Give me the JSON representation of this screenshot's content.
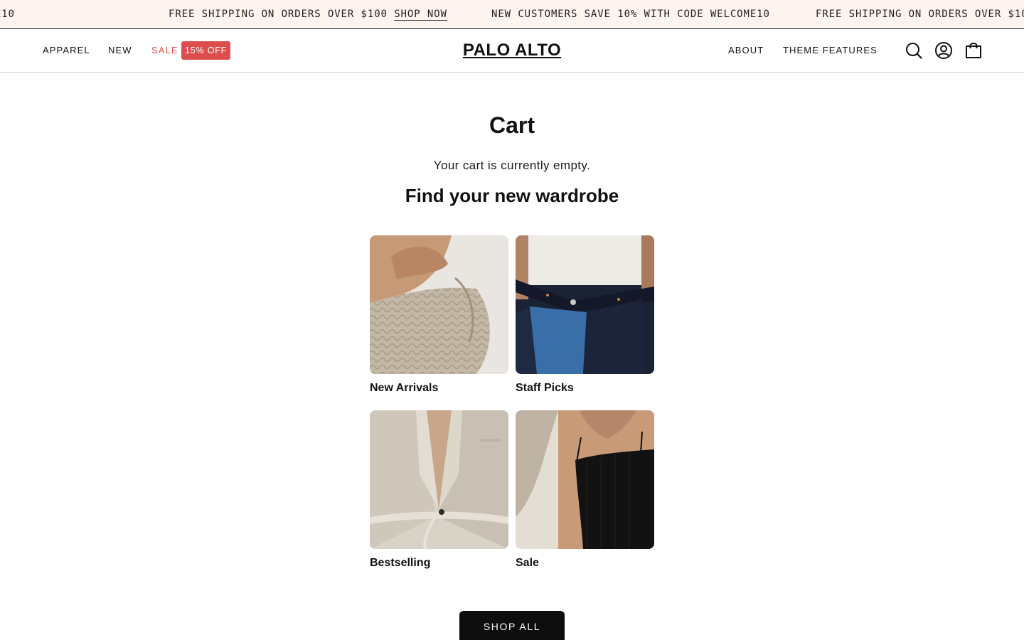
{
  "announcement": {
    "items": [
      {
        "text": "NEW CUSTOMERS SAVE 10% WITH CODE WELCOME10",
        "link": ""
      },
      {
        "text": "FREE SHIPPING ON ORDERS OVER $100",
        "link": "SHOP NOW"
      },
      {
        "text": "NEW CUSTOMERS SAVE 10% WITH CODE WELCOME10",
        "link": ""
      },
      {
        "text": "FREE SHIPPING ON ORDERS OVER $100",
        "link": ""
      }
    ]
  },
  "header": {
    "nav_left": [
      "APPAREL",
      "NEW",
      "SALE"
    ],
    "sale_badge": "15% OFF",
    "logo": "PALO ALTO",
    "nav_right": [
      "ABOUT",
      "THEME FEATURES"
    ],
    "icons": [
      "search-icon",
      "account-icon",
      "cart-bag-icon"
    ]
  },
  "main": {
    "title": "Cart",
    "empty_message": "Your cart is currently empty.",
    "heading": "Find your new wardrobe",
    "collections": [
      {
        "label": "New Arrivals"
      },
      {
        "label": "Staff Picks"
      },
      {
        "label": "Bestselling"
      },
      {
        "label": "Sale"
      }
    ],
    "shop_all": "SHOP ALL"
  },
  "colors": {
    "announcement_bg": "#fdf4ef",
    "sale_text": "#d9534f",
    "sale_badge_bg": "#dc4e4e",
    "button_bg": "#0d0d0d"
  }
}
